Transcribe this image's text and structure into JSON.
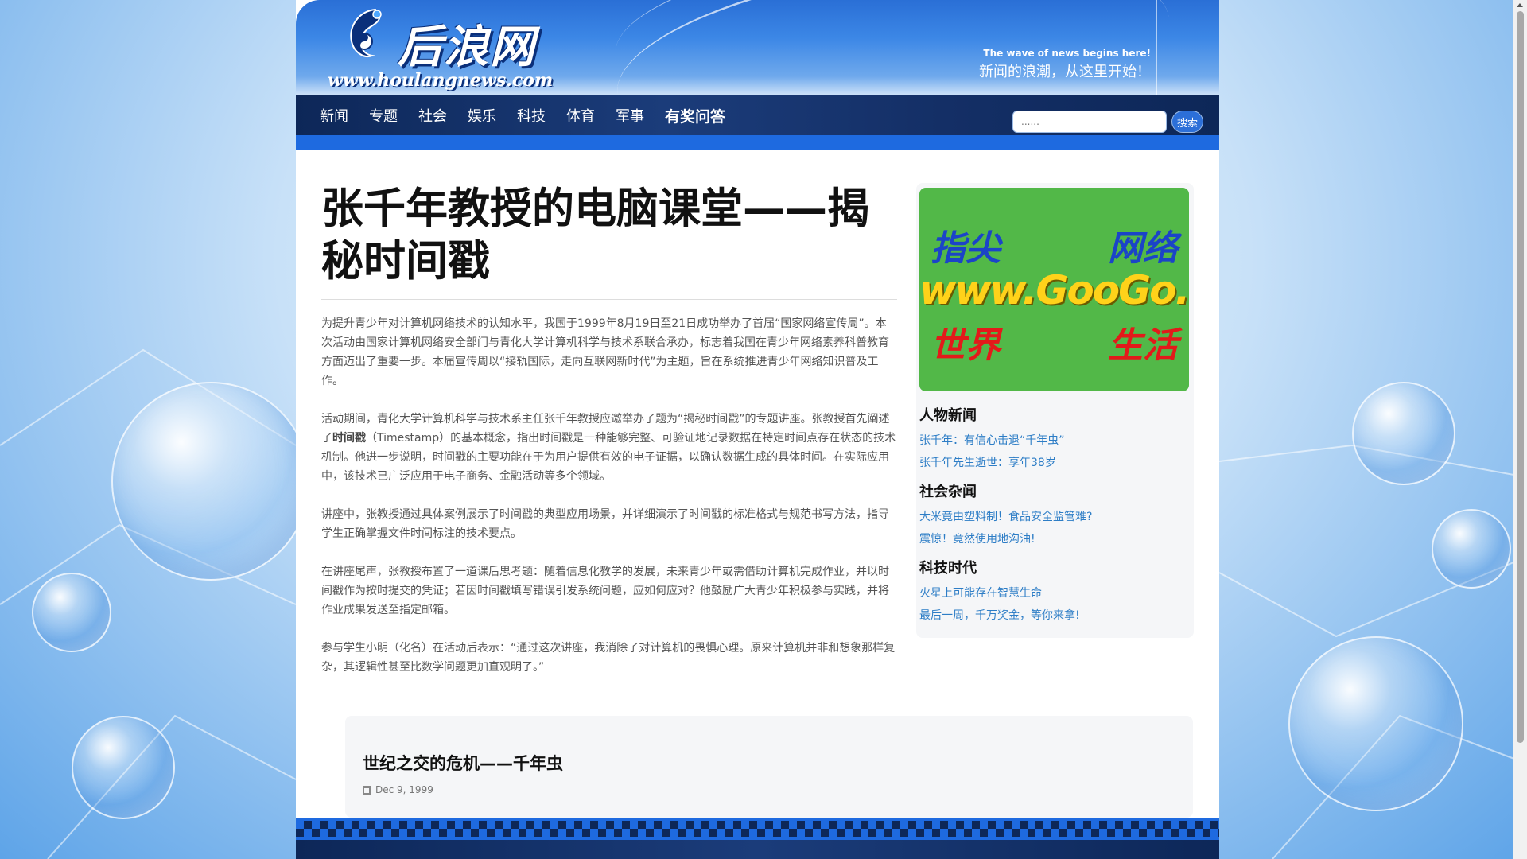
{
  "header": {
    "site_name": "后浪网",
    "site_url": "www.houlangnews.com",
    "tagline_en": "The wave of news begins here!",
    "tagline_cn": "新闻的浪潮，从这里开始！"
  },
  "nav": {
    "items": [
      "新闻",
      "专题",
      "社会",
      "娱乐",
      "科技",
      "体育",
      "军事",
      "有奖问答"
    ],
    "search_placeholder": "......",
    "search_button": "搜索"
  },
  "article": {
    "title": "张千年教授的电脑课堂——揭秘时间戳",
    "paragraphs": [
      "为提升青少年对计算机网络技术的认知水平，我国于1999年8月19日至21日成功举办了首届“国家网络宣传周”。本次活动由国家计算机网络安全部门与青化大学计算机科学与技术系联合承办，标志着我国在青少年网络素养科普教育方面迈出了重要一步。本届宣传周以“接轨国际，走向互联网新时代”为主题，旨在系统推进青少年网络知识普及工作。",
      "讲座中，张教授通过具体案例展示了时间戳的典型应用场景，并详细演示了时间戳的标准格式与规范书写方法，指导学生正确掌握文件时间标注的技术要点。",
      "在讲座尾声，张教授布置了一道课后思考题：随着信息化教学的发展，未来青少年或需借助计算机完成作业，并以时间戳作为按时提交的凭证；若因时间戳填写错误引发系统问题，应如何应对？他鼓励广大青少年积极参与实践，并将作业成果发送至指定邮箱。",
      "参与学生小明（化名）在活动后表示：“通过这次讲座，我消除了对计算机的畏惧心理。原来计算机并非和想象那样复杂，其逻辑性甚至比数学问题更加直观明了。”"
    ],
    "para2_before": "活动期间，青化大学计算机科学与技术系主任张千年教授应邀举办了题为“揭秘时间戳”的专题讲座。张教授首先阐述了",
    "para2_bold": "时间戳",
    "para2_after": "（Timestamp）的基本概念，指出时间戳是一种能够完整、可验证地记录数据在特定时间点存在状态的技术机制。他进一步说明，时间戳的主要功能在于为用户提供有效的电子证据，以确认数据生成的具体时间。在实际应用中，该技术已广泛应用于电子商务、金融活动等多个领域。"
  },
  "ad": {
    "top_left": "指尖",
    "top_right": "网络",
    "url": "www.GooGo.com",
    "bottom_left": "世界",
    "bottom_right": "生活"
  },
  "sidebar": {
    "sections": [
      {
        "title": "人物新闻",
        "links": [
          "张千年：有信心击退“千年虫”",
          "张千年先生逝世：享年38岁"
        ]
      },
      {
        "title": "社会杂闻",
        "links": [
          "大米竟由塑料制！食品安全监管难?",
          "震惊！竟然使用地沟油!"
        ]
      },
      {
        "title": "科技时代",
        "links": [
          "火星上可能存在智慧生命",
          "最后一周，千万奖金，等你来拿!"
        ]
      }
    ]
  },
  "related": {
    "title": "世纪之交的危机——千年虫",
    "date": "Dec 9, 1999"
  }
}
